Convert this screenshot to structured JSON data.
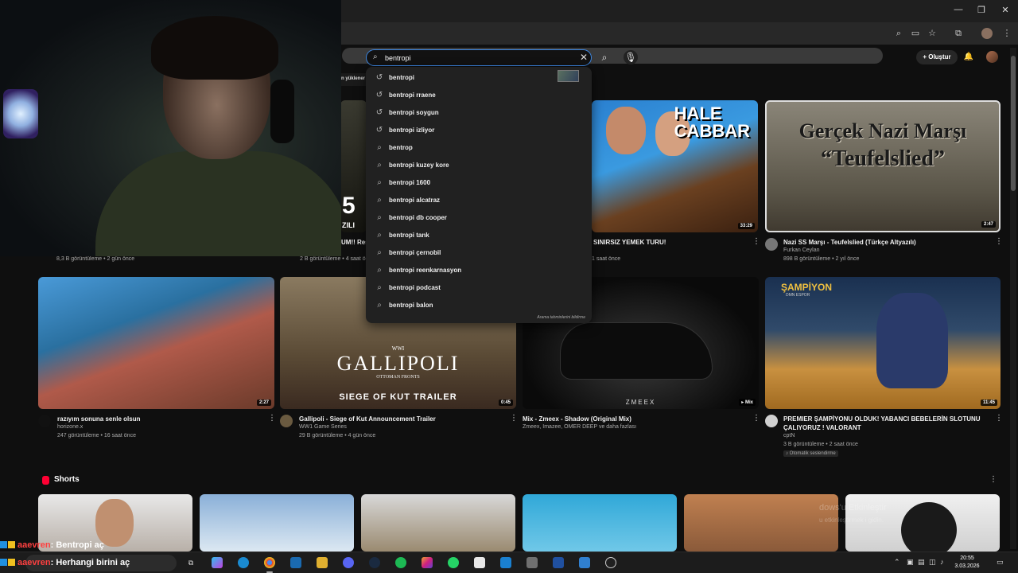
{
  "search": {
    "query": "bentropi"
  },
  "header": {
    "create_label": "Oluştur"
  },
  "suggestions": [
    {
      "text": "bentropi",
      "icon": "history-icon"
    },
    {
      "text": "bentropi rraene",
      "icon": "history-icon"
    },
    {
      "text": "bentropi soygun",
      "icon": "history-icon"
    },
    {
      "text": "bentropi izliyor",
      "icon": "history-icon"
    },
    {
      "text": "bentrop",
      "icon": "search-icon"
    },
    {
      "text": "bentropi kuzey kore",
      "icon": "search-icon"
    },
    {
      "text": "bentropi 1600",
      "icon": "search-icon"
    },
    {
      "text": "bentropi alcatraz",
      "icon": "search-icon"
    },
    {
      "text": "bentropi db cooper",
      "icon": "search-icon"
    },
    {
      "text": "bentropi tank",
      "icon": "search-icon"
    },
    {
      "text": "bentropi çernobil",
      "icon": "search-icon"
    },
    {
      "text": "bentropi reenkarnasyon",
      "icon": "search-icon"
    },
    {
      "text": "bentropi podcast",
      "icon": "search-icon"
    },
    {
      "text": "bentropi balon",
      "icon": "search-icon"
    }
  ],
  "suggest_report": "Arama tahminlerini bildirme",
  "row1": {
    "partial_banner": "n yüklener",
    "v1": {
      "thumb_num": "5",
      "thumb_text": "ZILI",
      "title": "UM!! Resi",
      "meta": "8,3 B görüntüleme • 2 gün önce"
    },
    "v2": {
      "meta_left": "2 B görüntüleme • 4 saat ön"
    },
    "v3": {
      "title": "SINIRSIZ YEMEK TURU!",
      "meta": "1 saat önce",
      "duration": "33:29",
      "thumb_text1": "HALE",
      "thumb_text2": "CABBAR"
    },
    "v4": {
      "title": "Nazi SS Marşı - Teufelslied (Türkçe Altyazılı)",
      "channel": "Furkan Ceylan",
      "meta": "898 B görüntüleme • 2 yıl önce",
      "duration": "2:47",
      "thumb_line1": "Gerçek Nazi Marşı",
      "thumb_line2": "“Teufelslied”"
    }
  },
  "row2": [
    {
      "title": "razıyım sonuna senle olsun",
      "channel": "horizone.x",
      "meta": "247 görüntüleme • 16 saat önce",
      "duration": "2:27"
    },
    {
      "title": "Gallipoli - Siege of Kut Announcement Trailer",
      "channel": "WW1 Game Series",
      "meta": "29 B görüntüleme • 4 gün önce",
      "duration": "0:45"
    },
    {
      "title": "Mix - Zmeex - Shadow (Original Mix)",
      "channel": "Zmeex, Imazee, OMER DEEP ve daha fazlası",
      "meta": "",
      "duration": "Mix"
    },
    {
      "title_line1": "PREMIER ŞAMPİYONU OLDUK! YABANCI BEBELERİN SLOTUNU",
      "title_line2": "ÇALIYORUZ ! VALORANT",
      "channel": "cptN",
      "meta": "3 B görüntüleme • 2 saat önce",
      "badge": "Otomatik seslendirme",
      "duration": "11:45"
    }
  ],
  "thumb_texts": {
    "gallipoli_top": "WWI",
    "gallipoli_main": "GALLIPOLI",
    "gallipoli_sub": "OTTOMAN FRONTS",
    "gallipoli_bottom": "SIEGE OF KUT TRAILER",
    "zmeex": "ZMEEX",
    "champ": "ŞAMPİYON",
    "champ_sub": "DMN ESPOR"
  },
  "shorts": {
    "label": "Shorts"
  },
  "chat": [
    {
      "user": "aaevren",
      "message": ": Bentropi aç"
    },
    {
      "user": "aaevren",
      "message": ": Herhangi birini aç"
    }
  ],
  "watermark": {
    "line1": "dows'u Etkinleştir",
    "line2": "u etkinleştirmek i          gidin."
  },
  "taskbar": {
    "time": "20:55",
    "date": "3.03.2026"
  },
  "colors": {
    "accent": "#3d86e0",
    "youtube_red": "#ff0033",
    "background": "#0f0f0f"
  }
}
